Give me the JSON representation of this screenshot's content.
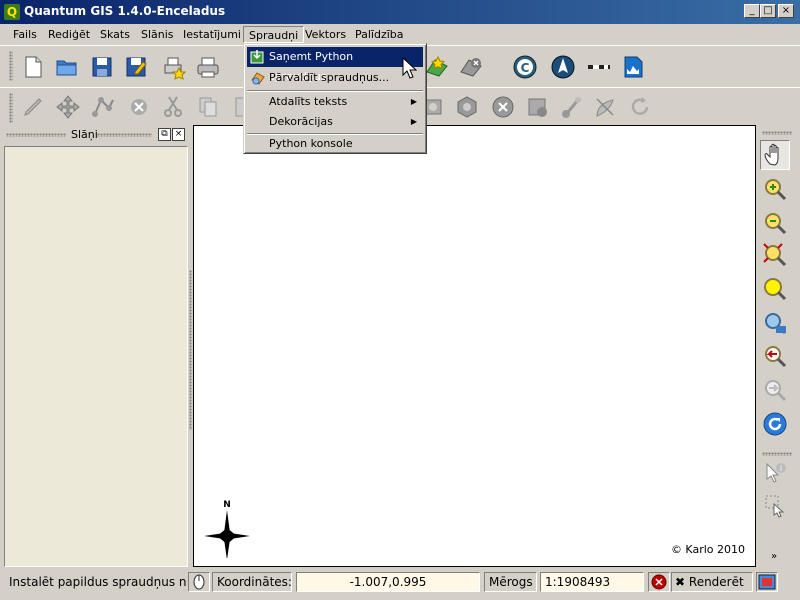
{
  "window": {
    "title": "Quantum GIS 1.4.0-Enceladus",
    "app_icon_letter": "Q",
    "buttons": {
      "minimize": "_",
      "maximize": "□",
      "close": "×"
    }
  },
  "menubar": {
    "items": [
      "Fails",
      "Rediģēt",
      "Skats",
      "Slānis",
      "Iestatījumi",
      "Spraudņi",
      "Vektors",
      "Palīdzība"
    ],
    "active": "Spraudņi"
  },
  "plugins_menu": {
    "items": [
      {
        "label": "Saņemt Python spraudņus...",
        "icon": "install-plugin-icon",
        "highlighted": true
      },
      {
        "label": "Pārvaldīt spraudņus...",
        "icon": "manage-plugins-icon"
      },
      {
        "label": "Atdalīts teksts",
        "submenu": true
      },
      {
        "label": "Dekorācijas",
        "submenu": true
      },
      {
        "label": "Python konsole"
      }
    ]
  },
  "layers_panel": {
    "title": "Slāņi",
    "buttons": {
      "float": "⧉",
      "close": "×"
    }
  },
  "map": {
    "copyright": "© Karlo 2010",
    "north_label": "N"
  },
  "statusbar": {
    "message": "Instalēt papildus spraudņus no a",
    "coordinates_label": "Koordinātes:",
    "coordinates_value": "-1.007,0.995",
    "scale_label": "Mērogs",
    "scale_value": "1:1908493",
    "render_label": "Renderēt"
  },
  "icons": {
    "toolbar1": [
      "new-project-icon",
      "open-project-icon",
      "save-project-icon",
      "save-as-icon",
      "print-composer-icon",
      "print-icon",
      "add-vector-icon",
      "remove-layer-icon",
      "copyright-icon",
      "north-arrow-icon",
      "scale-bar-icon",
      "save-image-icon"
    ],
    "toolbar2": [
      "edit-pencil-icon",
      "move-feature-icon",
      "node-tool-icon",
      "delete-selected-icon",
      "cut-icon",
      "copy-icon",
      "paste-icon",
      "add-ring-icon",
      "add-island-icon",
      "delete-ring-icon",
      "delete-part-icon",
      "reshape-icon",
      "split-icon",
      "merge-icon",
      "rotate-icon"
    ],
    "right_toolbar": [
      "pan-icon",
      "zoom-in-icon",
      "zoom-out-icon",
      "zoom-full-icon",
      "zoom-selection-icon",
      "zoom-layer-icon",
      "zoom-last-icon",
      "zoom-next-icon",
      "refresh-icon",
      "identify-icon",
      "select-icon"
    ]
  },
  "colors": {
    "titlebar_start": "#0a246a",
    "titlebar_end": "#3a6ea5",
    "menu_highlight": "#0a246a",
    "stop_button": "#c00000"
  }
}
